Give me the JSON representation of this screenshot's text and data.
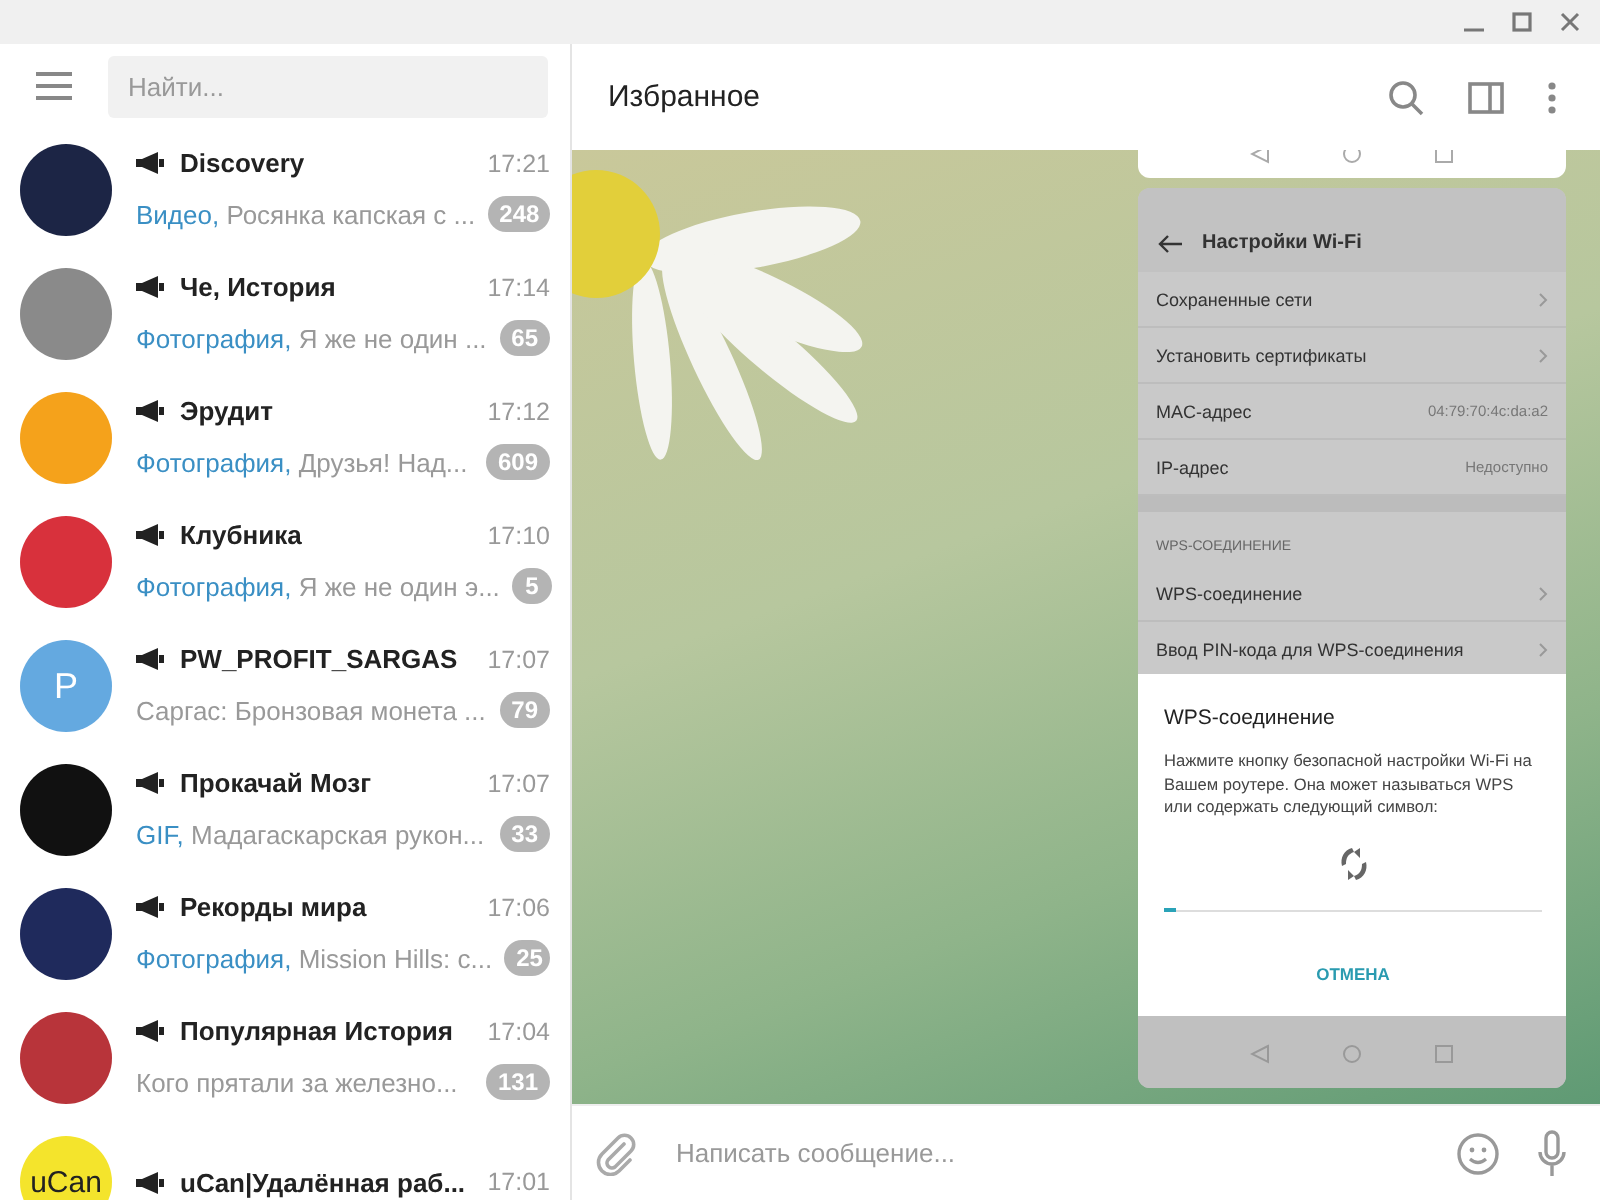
{
  "search": {
    "placeholder": "Найти..."
  },
  "chats": [
    {
      "name": "Discovery",
      "time": "17:21",
      "preview_type": "Видео,",
      "preview": "Росянка капская с ...",
      "unread": "248",
      "avatar": {
        "kind": "photo",
        "color": "#1c2545"
      }
    },
    {
      "name": "Че, История",
      "time": "17:14",
      "preview_type": "Фотография,",
      "preview": "Я же не один ...",
      "unread": "65",
      "avatar": {
        "kind": "photo",
        "color": "#8a8a8a"
      }
    },
    {
      "name": "Эрудит",
      "time": "17:12",
      "preview_type": "Фотография,",
      "preview": "Друзья!  Над...",
      "unread": "609",
      "avatar": {
        "kind": "photo",
        "color": "#f5a21b"
      }
    },
    {
      "name": "Клубника",
      "time": "17:10",
      "preview_type": "Фотография,",
      "preview": "Я же не один э...",
      "unread": "5",
      "avatar": {
        "kind": "photo",
        "color": "#d8313c"
      }
    },
    {
      "name": "PW_PROFIT_SARGAS",
      "time": "17:07",
      "preview": "Саргас: Бронзовая монета ...",
      "unread": "79",
      "avatar": {
        "kind": "letters",
        "color": "#64a9e0",
        "letters": "P"
      }
    },
    {
      "name": "Прокачай Мозг",
      "time": "17:07",
      "preview_type": "GIF,",
      "preview": "Мадагаскарская рукон...",
      "unread": "33",
      "avatar": {
        "kind": "photo",
        "color": "#111111"
      }
    },
    {
      "name": "Рекорды мира",
      "time": "17:06",
      "preview_type": "Фотография,",
      "preview": "Mission Hills: c...",
      "unread": "25",
      "avatar": {
        "kind": "photo",
        "color": "#1f2a5c"
      }
    },
    {
      "name": "Популярная История",
      "time": "17:04",
      "preview": "Кого прятали за железно...",
      "unread": "131",
      "avatar": {
        "kind": "photo",
        "color": "#b8343a"
      }
    },
    {
      "name": "uCan|Удалённая раб...",
      "time": "17:01",
      "avatar": {
        "kind": "letters",
        "color": "#f4e42c",
        "letters": "uCan"
      }
    }
  ],
  "chat": {
    "title": "Избранное"
  },
  "screenshot": {
    "title": "Настройки Wi-Fi",
    "rows": [
      {
        "kind": "link",
        "label": "Сохраненные сети"
      },
      {
        "kind": "link",
        "label": "Установить сертификаты"
      },
      {
        "kind": "value",
        "label": "MAC-адрес",
        "value": "04:79:70:4c:da:a2"
      },
      {
        "kind": "value",
        "label": "IP-адрес",
        "value": "Недоступно"
      },
      {
        "kind": "section",
        "label": "WPS-СОЕДИНЕНИЕ"
      },
      {
        "kind": "link",
        "label": "WPS-соединение"
      },
      {
        "kind": "link",
        "label": "Ввод PIN-кода для WPS-соединения"
      }
    ],
    "dialog": {
      "title": "WPS-соединение",
      "text": "Нажмите кнопку безопасной настройки Wi-Fi на Вашем роутере. Она может называться WPS или содержать следующий символ:",
      "progress": {
        "level": 0.03
      },
      "button": "ОТМЕНА"
    }
  },
  "composer": {
    "placeholder": "Написать сообщение..."
  }
}
